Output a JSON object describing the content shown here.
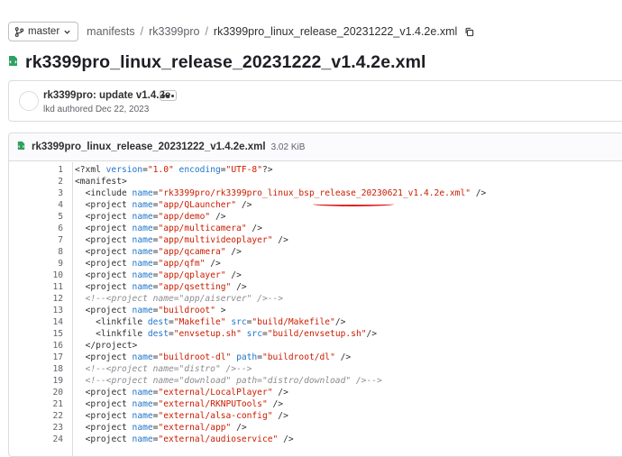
{
  "breadcrumb": {
    "branch": "master",
    "parts": [
      "manifests",
      "rk3399pro"
    ],
    "current": "rk3399pro_linux_release_20231222_v1.4.2e.xml"
  },
  "page_title": "rk3399pro_linux_release_20231222_v1.4.2e.xml",
  "commit": {
    "message": "rk3399pro: update v1.4.2e",
    "author": "lkd",
    "meta": "lkd authored Dec 22, 2023"
  },
  "file": {
    "name": "rk3399pro_linux_release_20231222_v1.4.2e.xml",
    "size": "3.02 KiB"
  },
  "code_lines": [
    {
      "n": "1",
      "indent": 0,
      "tokens": [
        [
          "t",
          "<?xml "
        ],
        [
          "a",
          "version"
        ],
        [
          "t",
          "="
        ],
        [
          "s",
          "\"1.0\""
        ],
        [
          "t",
          " "
        ],
        [
          "a",
          "encoding"
        ],
        [
          "t",
          "="
        ],
        [
          "s",
          "\"UTF-8\""
        ],
        [
          "t",
          "?>"
        ]
      ]
    },
    {
      "n": "2",
      "indent": 0,
      "tokens": [
        [
          "t",
          "<manifest>"
        ]
      ]
    },
    {
      "n": "3",
      "indent": 1,
      "tokens": [
        [
          "t",
          "<include "
        ],
        [
          "a",
          "name"
        ],
        [
          "t",
          "="
        ],
        [
          "s",
          "\"rk3399pro/rk3399pro_linux_bsp_release_20230621_v1.4.2e.xml\""
        ],
        [
          "t",
          " />"
        ]
      ]
    },
    {
      "n": "4",
      "indent": 1,
      "tokens": [
        [
          "t",
          "<project "
        ],
        [
          "a",
          "name"
        ],
        [
          "t",
          "="
        ],
        [
          "s",
          "\"app/QLauncher\""
        ],
        [
          "t",
          " />"
        ]
      ]
    },
    {
      "n": "5",
      "indent": 1,
      "tokens": [
        [
          "t",
          "<project "
        ],
        [
          "a",
          "name"
        ],
        [
          "t",
          "="
        ],
        [
          "s",
          "\"app/demo\""
        ],
        [
          "t",
          " />"
        ]
      ]
    },
    {
      "n": "6",
      "indent": 1,
      "tokens": [
        [
          "t",
          "<project "
        ],
        [
          "a",
          "name"
        ],
        [
          "t",
          "="
        ],
        [
          "s",
          "\"app/multicamera\""
        ],
        [
          "t",
          " />"
        ]
      ]
    },
    {
      "n": "7",
      "indent": 1,
      "tokens": [
        [
          "t",
          "<project "
        ],
        [
          "a",
          "name"
        ],
        [
          "t",
          "="
        ],
        [
          "s",
          "\"app/multivideoplayer\""
        ],
        [
          "t",
          " />"
        ]
      ]
    },
    {
      "n": "8",
      "indent": 1,
      "tokens": [
        [
          "t",
          "<project "
        ],
        [
          "a",
          "name"
        ],
        [
          "t",
          "="
        ],
        [
          "s",
          "\"app/qcamera\""
        ],
        [
          "t",
          " />"
        ]
      ]
    },
    {
      "n": "9",
      "indent": 1,
      "tokens": [
        [
          "t",
          "<project "
        ],
        [
          "a",
          "name"
        ],
        [
          "t",
          "="
        ],
        [
          "s",
          "\"app/qfm\""
        ],
        [
          "t",
          " />"
        ]
      ]
    },
    {
      "n": "10",
      "indent": 1,
      "tokens": [
        [
          "t",
          "<project "
        ],
        [
          "a",
          "name"
        ],
        [
          "t",
          "="
        ],
        [
          "s",
          "\"app/qplayer\""
        ],
        [
          "t",
          " />"
        ]
      ]
    },
    {
      "n": "11",
      "indent": 1,
      "tokens": [
        [
          "t",
          "<project "
        ],
        [
          "a",
          "name"
        ],
        [
          "t",
          "="
        ],
        [
          "s",
          "\"app/qsetting\""
        ],
        [
          "t",
          " />"
        ]
      ]
    },
    {
      "n": "12",
      "indent": 1,
      "tokens": [
        [
          "c",
          "<!--<project name=\"app/aiserver\" />-->"
        ]
      ]
    },
    {
      "n": "13",
      "indent": 1,
      "tokens": [
        [
          "t",
          "<project "
        ],
        [
          "a",
          "name"
        ],
        [
          "t",
          "="
        ],
        [
          "s",
          "\"buildroot\""
        ],
        [
          "t",
          " >"
        ]
      ]
    },
    {
      "n": "14",
      "indent": 2,
      "tokens": [
        [
          "t",
          "<linkfile "
        ],
        [
          "a",
          "dest"
        ],
        [
          "t",
          "="
        ],
        [
          "s",
          "\"Makefile\""
        ],
        [
          "t",
          " "
        ],
        [
          "a",
          "src"
        ],
        [
          "t",
          "="
        ],
        [
          "s",
          "\"build/Makefile\""
        ],
        [
          "t",
          "/>"
        ]
      ]
    },
    {
      "n": "15",
      "indent": 2,
      "tokens": [
        [
          "t",
          "<linkfile "
        ],
        [
          "a",
          "dest"
        ],
        [
          "t",
          "="
        ],
        [
          "s",
          "\"envsetup.sh\""
        ],
        [
          "t",
          " "
        ],
        [
          "a",
          "src"
        ],
        [
          "t",
          "="
        ],
        [
          "s",
          "\"build/envsetup.sh\""
        ],
        [
          "t",
          "/>"
        ]
      ]
    },
    {
      "n": "16",
      "indent": 1,
      "tokens": [
        [
          "t",
          "</project>"
        ]
      ]
    },
    {
      "n": "17",
      "indent": 1,
      "tokens": [
        [
          "t",
          "<project "
        ],
        [
          "a",
          "name"
        ],
        [
          "t",
          "="
        ],
        [
          "s",
          "\"buildroot-dl\""
        ],
        [
          "t",
          " "
        ],
        [
          "a",
          "path"
        ],
        [
          "t",
          "="
        ],
        [
          "s",
          "\"buildroot/dl\""
        ],
        [
          "t",
          " />"
        ]
      ]
    },
    {
      "n": "18",
      "indent": 1,
      "tokens": [
        [
          "c",
          "<!--<project name=\"distro\" />-->"
        ]
      ]
    },
    {
      "n": "19",
      "indent": 1,
      "tokens": [
        [
          "c",
          "<!--<project name=\"download\" path=\"distro/download\" />-->"
        ]
      ]
    },
    {
      "n": "20",
      "indent": 1,
      "tokens": [
        [
          "t",
          "<project "
        ],
        [
          "a",
          "name"
        ],
        [
          "t",
          "="
        ],
        [
          "s",
          "\"external/LocalPlayer\""
        ],
        [
          "t",
          " />"
        ]
      ]
    },
    {
      "n": "21",
      "indent": 1,
      "tokens": [
        [
          "t",
          "<project "
        ],
        [
          "a",
          "name"
        ],
        [
          "t",
          "="
        ],
        [
          "s",
          "\"external/RKNPUTools\""
        ],
        [
          "t",
          " />"
        ]
      ]
    },
    {
      "n": "22",
      "indent": 1,
      "tokens": [
        [
          "t",
          "<project "
        ],
        [
          "a",
          "name"
        ],
        [
          "t",
          "="
        ],
        [
          "s",
          "\"external/alsa-config\""
        ],
        [
          "t",
          " />"
        ]
      ]
    },
    {
      "n": "23",
      "indent": 1,
      "tokens": [
        [
          "t",
          "<project "
        ],
        [
          "a",
          "name"
        ],
        [
          "t",
          "="
        ],
        [
          "s",
          "\"external/app\""
        ],
        [
          "t",
          " />"
        ]
      ]
    },
    {
      "n": "24",
      "indent": 1,
      "tokens": [
        [
          "t",
          "<project "
        ],
        [
          "a",
          "name"
        ],
        [
          "t",
          "="
        ],
        [
          "s",
          "\"external/audioservice\""
        ],
        [
          "t",
          " />"
        ]
      ]
    }
  ],
  "colors": {
    "tag": "#303030",
    "attr": "#1f75cb",
    "string": "#c91c00",
    "comment": "#8c8b91",
    "annotation_underline": "#e02020",
    "file_icon": "#2da160"
  },
  "icons": {
    "branch": "git-branch-icon",
    "dropdown": "chevron-down-icon",
    "copy": "copy-icon",
    "file": "xml-file-icon",
    "more": "ellipsis-icon"
  }
}
